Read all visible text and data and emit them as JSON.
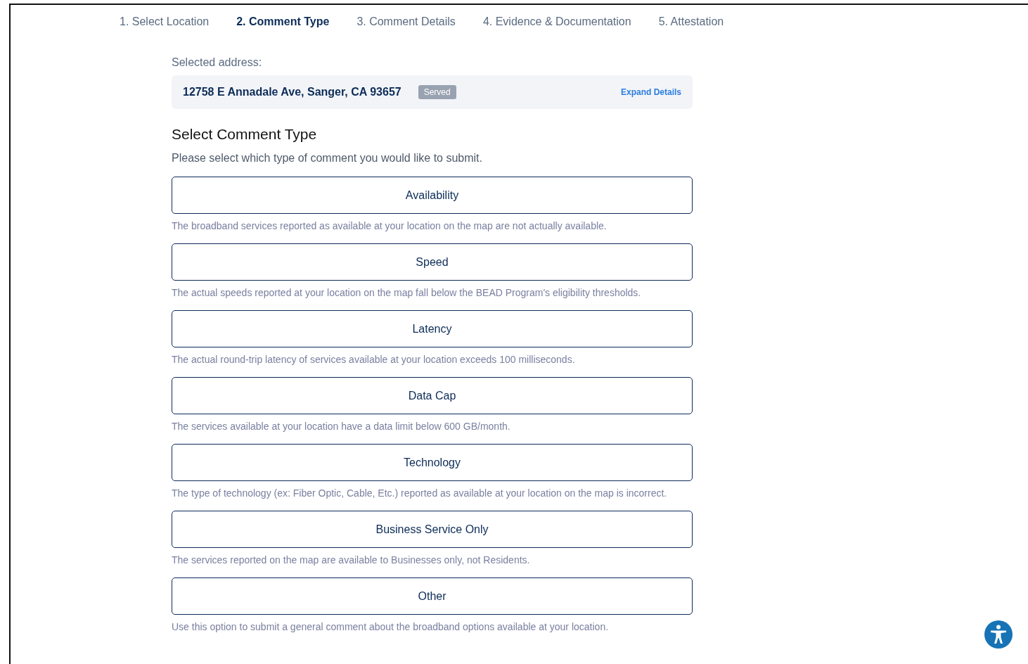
{
  "steps": [
    {
      "label": "1. Select Location",
      "selected": false
    },
    {
      "label": "2. Comment Type",
      "selected": true
    },
    {
      "label": "3. Comment Details",
      "selected": false
    },
    {
      "label": "4. Evidence & Documentation",
      "selected": false
    },
    {
      "label": "5. Attestation",
      "selected": false
    }
  ],
  "address": {
    "label": "Selected address:",
    "value": "12758 E Annadale Ave, Sanger, CA 93657",
    "badge": "Served",
    "link": "Expand Details"
  },
  "heading": "Select Comment Type",
  "intro": "Please select which type of comment you would like to submit.",
  "options": [
    {
      "label": "Availability",
      "description": "The broadband services reported as available at your location on the map are not actually available."
    },
    {
      "label": "Speed",
      "description": "The actual speeds reported at your location on the map fall below the BEAD Program's eligibility thresholds."
    },
    {
      "label": "Latency",
      "description": "The actual round-trip latency of services available at your location exceeds 100 milliseconds."
    },
    {
      "label": "Data Cap",
      "description": "The services available at your location have a data limit below 600 GB/month."
    },
    {
      "label": "Technology",
      "description": "The type of technology (ex: Fiber Optic, Cable, Etc.) reported as available at your location on the map is incorrect."
    },
    {
      "label": "Business Service Only",
      "description": "The services reported on the map are available to Businesses only, not Residents."
    },
    {
      "label": "Other",
      "description": "Use this option to submit a general comment about the broadband options available at your location."
    }
  ]
}
